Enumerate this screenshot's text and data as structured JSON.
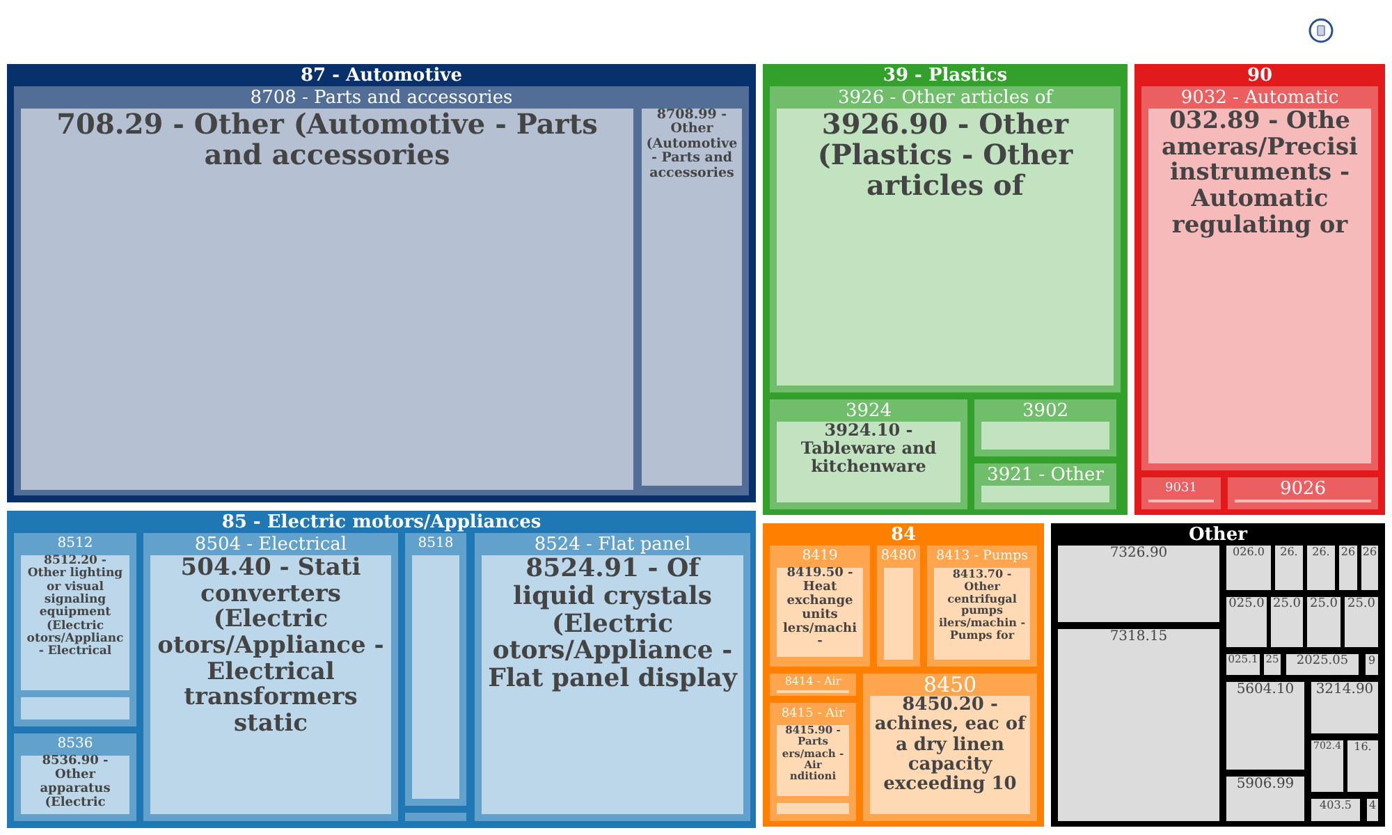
{
  "treemap": {
    "groups": [
      {
        "label": "87 - Automotive",
        "color": "#08306b",
        "children": [
          {
            "label": "8708 - Parts and accessories",
            "children": [
              {
                "label": "708.29 - Other (Automotive - Parts and accessories"
              },
              {
                "label": "8708.99 - Other (Automotive - Parts and accessories"
              }
            ]
          }
        ]
      },
      {
        "label": "39 - Plastics",
        "color": "#33a02c",
        "children": [
          {
            "label": "3926 - Other articles of",
            "children": [
              {
                "label": "3926.90 - Other (Plastics - Other articles of"
              }
            ]
          },
          {
            "label": "3924",
            "children": [
              {
                "label": "3924.10 - Tableware and kitchenware"
              }
            ]
          },
          {
            "label": "3902"
          },
          {
            "label": "3921 - Other"
          }
        ]
      },
      {
        "label": "90",
        "color": "#e31a1c",
        "children": [
          {
            "label": "9032 - Automatic",
            "children": [
              {
                "label": "032.89 - Othe ameras/Precisi instruments - Automatic regulating or"
              }
            ]
          },
          {
            "label": "9031"
          },
          {
            "label": "9026"
          }
        ]
      },
      {
        "label": "85 - Electric motors/Appliances",
        "color": "#1f78b4",
        "children": [
          {
            "label": "8512",
            "children": [
              {
                "label": "8512.20 - Other lighting or visual signaling equipment (Electric otors/Applianc - Electrical"
              }
            ]
          },
          {
            "label": "8536",
            "children": [
              {
                "label": "8536.90 - Other apparatus (Electric"
              }
            ]
          },
          {
            "label": "8504 - Electrical",
            "children": [
              {
                "label": "504.40 - Stati converters (Electric otors/Appliance - Electrical transformers static"
              }
            ]
          },
          {
            "label": "8518"
          },
          {
            "label": "8524 - Flat panel",
            "children": [
              {
                "label": "8524.91 - Of liquid crystals (Electric otors/Appliance - Flat panel display"
              }
            ]
          }
        ]
      },
      {
        "label": "84",
        "color": "#ff7f00",
        "children": [
          {
            "label": "8419",
            "children": [
              {
                "label": "8419.50 - Heat exchange units lers/machi -"
              }
            ]
          },
          {
            "label": "8480"
          },
          {
            "label": "8413 - Pumps",
            "children": [
              {
                "label": "8413.70 - Other centrifugal pumps ilers/machin - Pumps for"
              }
            ]
          },
          {
            "label": "8414 - Air"
          },
          {
            "label": "8415 - Air",
            "children": [
              {
                "label": "8415.90 - Parts ers/mach - Air nditioni"
              }
            ]
          },
          {
            "label": "8450",
            "children": [
              {
                "label": "8450.20 - achines, eac of a dry linen capacity exceeding 10"
              }
            ]
          }
        ]
      },
      {
        "label": "Other",
        "color": "#000000",
        "children": [
          {
            "label": "7326.90"
          },
          {
            "label": "7318.15"
          },
          {
            "label": "026.0"
          },
          {
            "label": "26."
          },
          {
            "label": "26."
          },
          {
            "label": "26"
          },
          {
            "label": "26"
          },
          {
            "label": "025.0"
          },
          {
            "label": "25.0"
          },
          {
            "label": "25.0"
          },
          {
            "label": "25.0"
          },
          {
            "label": "025.1"
          },
          {
            "label": "25"
          },
          {
            "label": "2025.05"
          },
          {
            "label": "9"
          },
          {
            "label": "5604.10"
          },
          {
            "label": "5906.99"
          },
          {
            "label": "3214.90"
          },
          {
            "label": "702.4"
          },
          {
            "label": "16."
          },
          {
            "label": "403.5"
          },
          {
            "label": "4"
          }
        ]
      }
    ]
  }
}
